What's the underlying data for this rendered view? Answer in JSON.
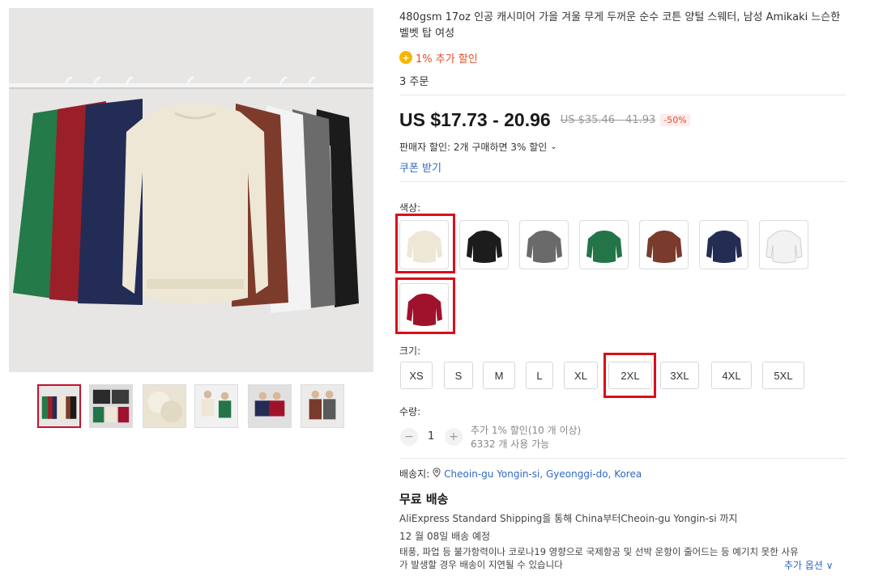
{
  "product": {
    "title": "480gsm 17oz 인공 캐시미어 가을 겨울 무게 두꺼운 순수 코튼 양털 스웨터, 남성 Amikaki 느슨한 벨벳 탑 여성",
    "bonus_coin": "+",
    "bonus_text": "1% 추가 할인",
    "orders": "3 주문",
    "price": "US $17.73 - 20.96",
    "original_price": "US $35.46 - 41.93",
    "discount": "-50%",
    "seller_discount": "판매자 할인: 2개 구매하면 3% 할인",
    "coupon": "쿠폰 받기"
  },
  "color": {
    "label": "색상:",
    "options": [
      {
        "name": "cream",
        "hex": "#efe7d6"
      },
      {
        "name": "black",
        "hex": "#1c1c1c"
      },
      {
        "name": "gray",
        "hex": "#6a6a6a"
      },
      {
        "name": "green",
        "hex": "#237447"
      },
      {
        "name": "brown",
        "hex": "#7a3a2c"
      },
      {
        "name": "navy",
        "hex": "#232c52"
      },
      {
        "name": "white",
        "hex": "#f2f2f2"
      },
      {
        "name": "wine",
        "hex": "#a0122c"
      }
    ]
  },
  "size": {
    "label": "크기:",
    "options": [
      "XS",
      "S",
      "M",
      "L",
      "XL",
      "2XL",
      "3XL",
      "4XL",
      "5XL"
    ]
  },
  "quantity": {
    "label": "수량:",
    "minus": "−",
    "value": "1",
    "plus": "+",
    "note1": "추가 1% 할인(10 개 이상)",
    "note2": "6332 개 사용 가능"
  },
  "shipping": {
    "to_label": "배송지:",
    "location": "Cheoin-gu Yongin-si, Gyeonggi-do, Korea",
    "free": "무료 배송",
    "method": "AliExpress Standard Shipping을 통해 China부터Cheoin-gu Yongin-si 까지",
    "eta": "12 월 08일 배송 예정",
    "notice1": "태풍, 파업 등 불가항력이나 코로나19 영향으로 국제항공 및 선박 운항이 줄어드는 등 예기치 못한 사유",
    "notice2": "가 발생할 경우 배송이 지연될 수 있습니다",
    "more": "추가 옵션 ∨"
  },
  "gallery": {
    "main_colors": [
      "#247a48",
      "#9b1f28",
      "#232c55",
      "#efe7d6",
      "#7d3b2b",
      "#f3f3f3",
      "#6b6b6b",
      "#1a1a1a"
    ],
    "thumb_count": 6
  },
  "accent": "#d9101b"
}
